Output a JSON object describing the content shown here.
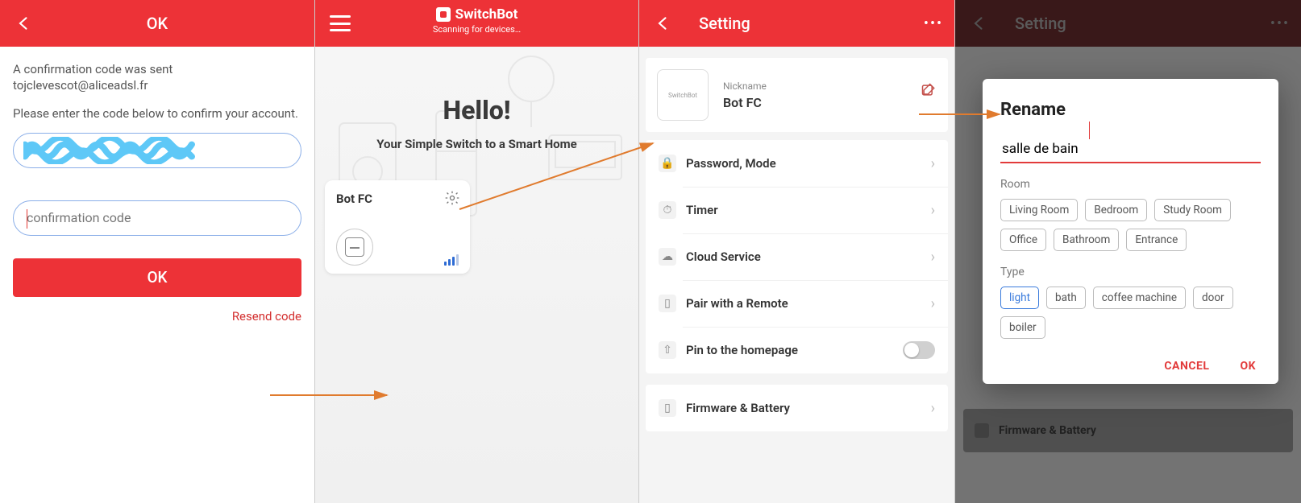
{
  "panel1": {
    "title": "OK",
    "msg1": "A confirmation code was sent tojclevescot@aliceadsl.fr",
    "msg2": "Please enter the code below to confirm your account.",
    "placeholder": "confirmation code",
    "ok_btn": "OK",
    "resend": "Resend code"
  },
  "panel2": {
    "brand": "SwitchBot",
    "scanning": "Scanning for devices…",
    "hello": "Hello!",
    "tagline": "Your Simple Switch to a Smart Home",
    "device": "Bot FC"
  },
  "panel3": {
    "title": "Setting",
    "nickname_label": "Nickname",
    "nickname_value": "Bot FC",
    "rows": {
      "password": "Password, Mode",
      "timer": "Timer",
      "cloud": "Cloud Service",
      "pair": "Pair with a Remote",
      "pin": "Pin to the homepage",
      "firmware": "Firmware & Battery"
    }
  },
  "panel4": {
    "title": "Setting",
    "bg_firmware": "Firmware & Battery",
    "dialog": {
      "title": "Rename",
      "input_value": "salle de bain",
      "room_label": "Room",
      "rooms": [
        "Living Room",
        "Bedroom",
        "Study Room",
        "Office",
        "Bathroom",
        "Entrance"
      ],
      "type_label": "Type",
      "types": [
        "light",
        "bath",
        "coffee machine",
        "door",
        "boiler"
      ],
      "type_selected": "light",
      "cancel": "CANCEL",
      "ok": "OK"
    }
  }
}
